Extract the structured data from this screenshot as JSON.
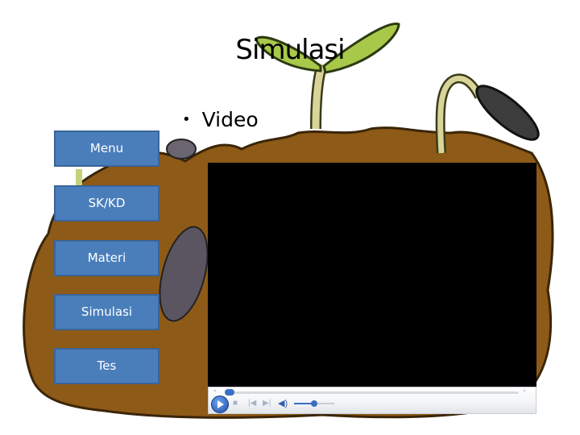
{
  "slide": {
    "title": "Simulasi",
    "bullet": "Video"
  },
  "nav": {
    "buttons": [
      {
        "label": "Menu"
      },
      {
        "label": "SK/KD"
      },
      {
        "label": "Materi"
      },
      {
        "label": "Simulasi"
      },
      {
        "label": "Tes"
      }
    ]
  },
  "player": {
    "state": "stopped",
    "seek_progress": 0.0,
    "volume": 0.5,
    "icons": {
      "rewind": "«",
      "fast_forward": "»",
      "stop": "■",
      "previous": "|◀",
      "next": "▶|",
      "volume": "🔊"
    }
  },
  "colors": {
    "nav_button": "#4a7ebb",
    "soil": "#8a5a1a",
    "leaf": "#a8c84a"
  }
}
